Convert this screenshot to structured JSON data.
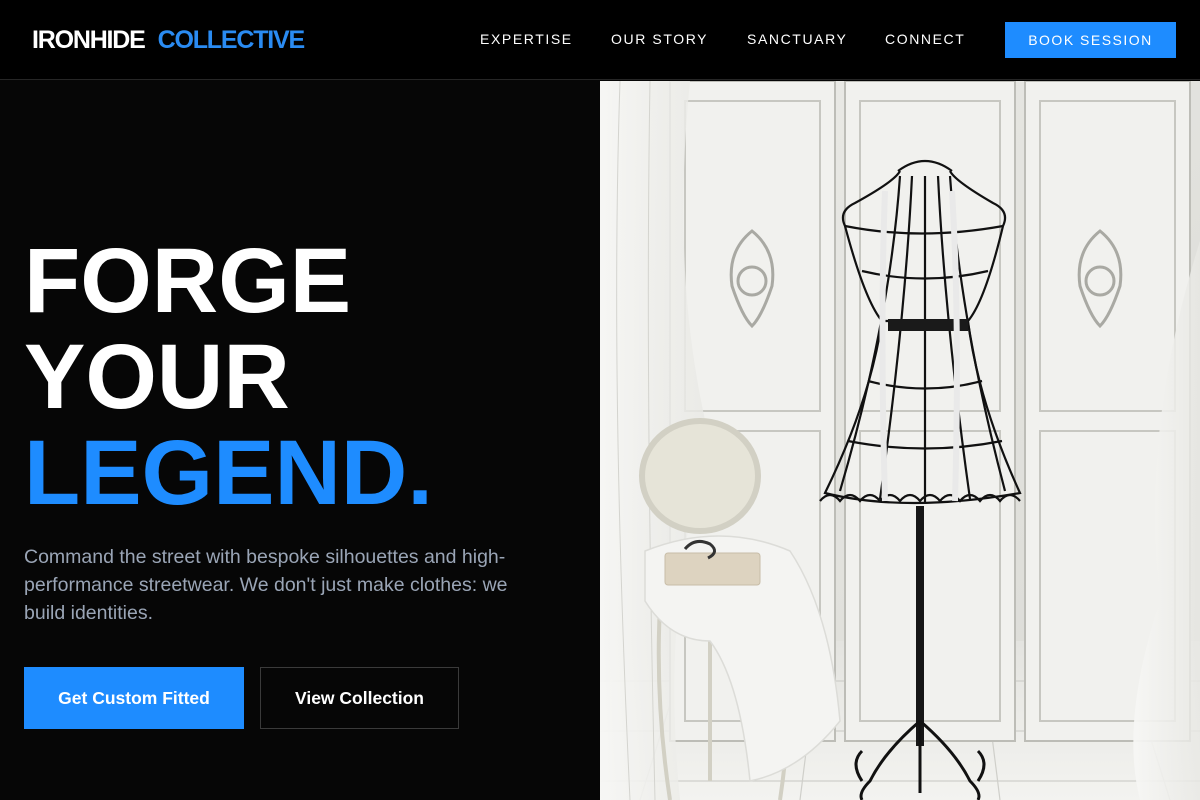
{
  "brand": {
    "word1": "IRONHIDE",
    "word2": "COLLECTIVE"
  },
  "nav": {
    "items": [
      {
        "label": "EXPERTISE"
      },
      {
        "label": "OUR STORY"
      },
      {
        "label": "SANCTUARY"
      },
      {
        "label": "CONNECT"
      }
    ],
    "cta_label": "BOOK SESSION"
  },
  "hero": {
    "line1": "FORGE",
    "line2": "YOUR",
    "line3": "LEGEND.",
    "subtitle": "Command the street with bespoke silhouettes and high-performance streetwear. We don't just make clothes: we build identities.",
    "primary_cta": "Get Custom Fitted",
    "secondary_cta": "View Collection",
    "image_icon": "wire-dress-form-photo"
  },
  "colors": {
    "accent": "#1e8cff",
    "background": "#060606",
    "subtitle": "#9aa5b6"
  }
}
